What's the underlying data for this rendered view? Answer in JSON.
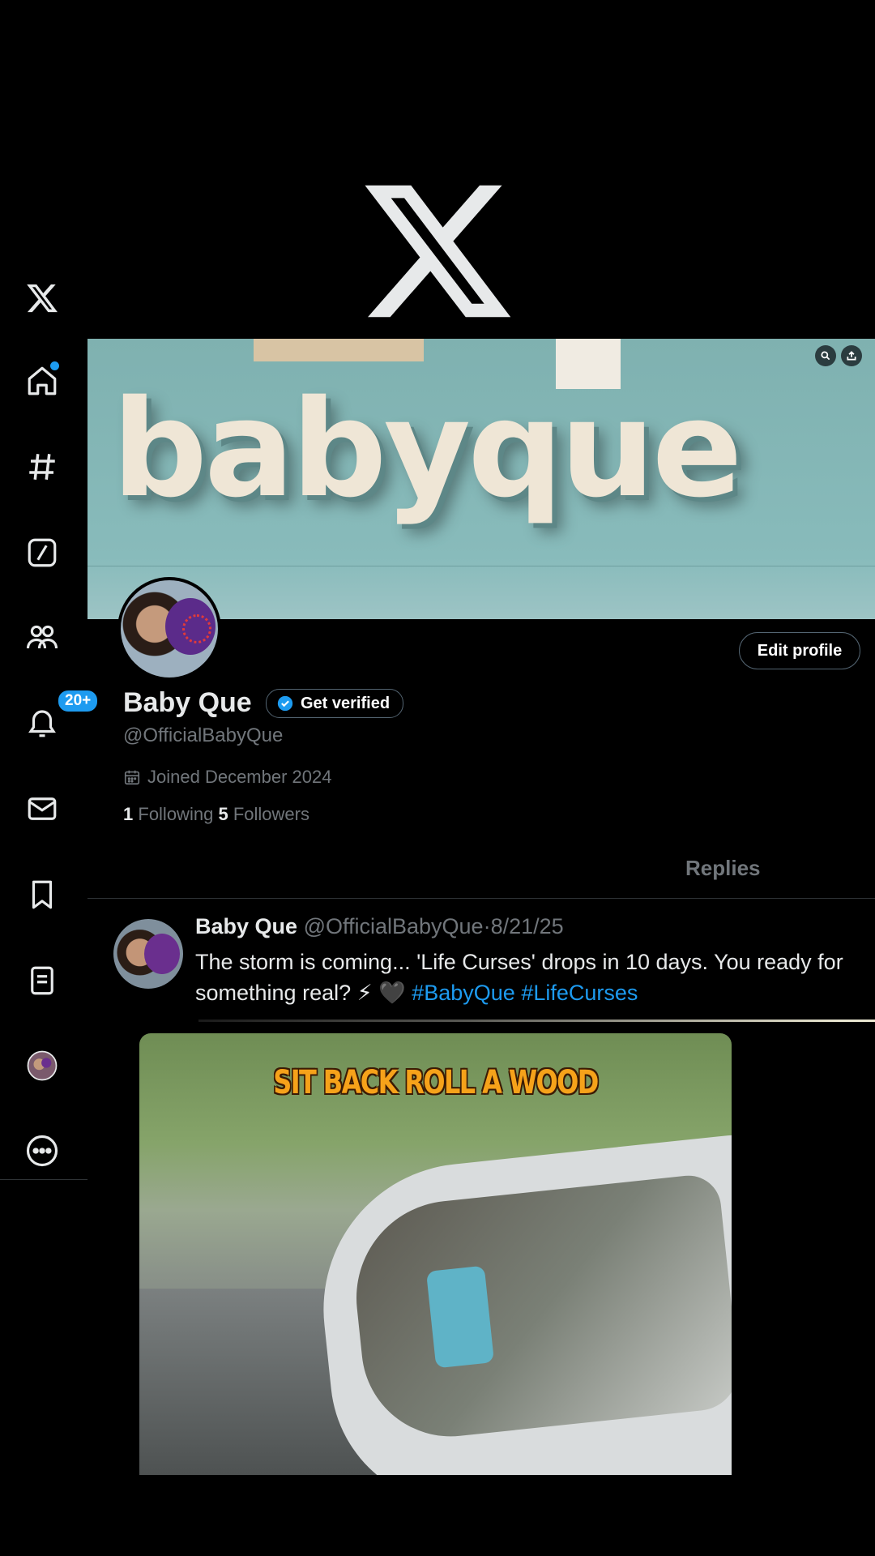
{
  "app": {
    "name": "X",
    "accent": "#1d9bf0"
  },
  "sidebar": {
    "items": [
      {
        "name": "x-logo"
      },
      {
        "name": "home",
        "has_dot": true
      },
      {
        "name": "explore"
      },
      {
        "name": "grok"
      },
      {
        "name": "communities"
      },
      {
        "name": "notifications",
        "badge": "20+"
      },
      {
        "name": "messages"
      },
      {
        "name": "bookmarks"
      },
      {
        "name": "lists"
      },
      {
        "name": "profile"
      },
      {
        "name": "more"
      }
    ]
  },
  "banner": {
    "text": "babyque"
  },
  "profile": {
    "display_name": "Baby Que",
    "get_verified_label": "Get verified",
    "handle": "@OfficialBabyQue",
    "joined": "Joined December 2024",
    "following_count": "1",
    "following_label": "Following",
    "followers_count": "5",
    "followers_label": "Followers",
    "edit_profile_label": "Edit profile"
  },
  "tabs": {
    "replies": "Replies"
  },
  "tweet": {
    "name": "Baby Que",
    "handle": "@OfficialBabyQue",
    "separator": "·",
    "date": "8/21/25",
    "text": "The storm is coming... 'Life Curses' drops in 10 days. You ready for something real? ⚡ 🖤",
    "hashtag1": "#BabyQue",
    "hashtag2": "#LifeCurses",
    "media_caption": "SIT BACK ROLL A WOOD"
  }
}
